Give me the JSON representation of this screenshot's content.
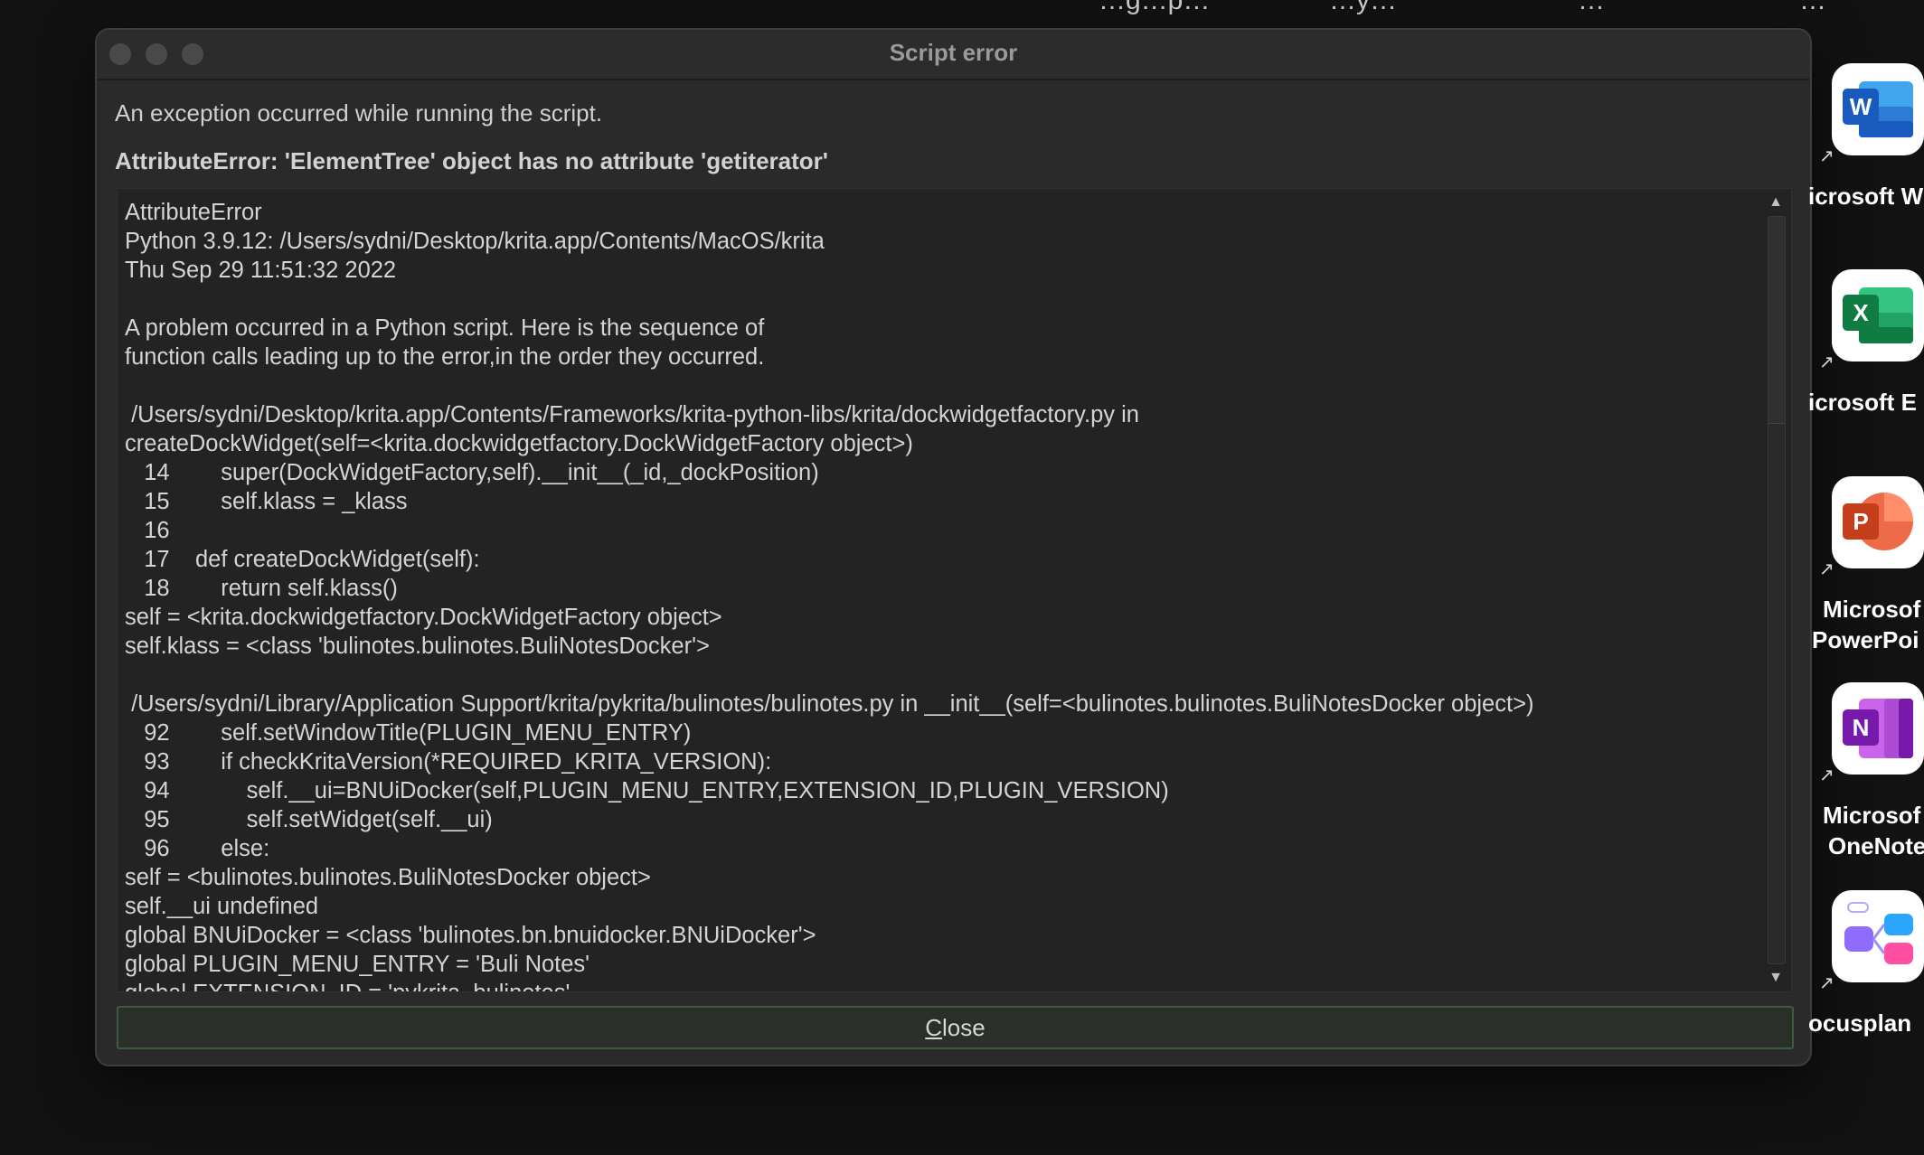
{
  "desktop": {
    "top_labels": [
      "…g…p…",
      "…y…",
      "…",
      "…"
    ]
  },
  "window": {
    "title": "Script error",
    "message": "An exception occurred while running the script.",
    "error_title": "AttributeError: 'ElementTree' object has no attribute 'getiterator'",
    "traceback_lines": [
      "AttributeError",
      "Python 3.9.12: /Users/sydni/Desktop/krita.app/Contents/MacOS/krita",
      "Thu Sep 29 11:51:32 2022",
      "",
      "A problem occurred in a Python script. Here is the sequence of",
      "function calls leading up to the error,in the order they occurred.",
      "",
      " /Users/sydni/Desktop/krita.app/Contents/Frameworks/krita-python-libs/krita/dockwidgetfactory.py in",
      "createDockWidget(self=<krita.dockwidgetfactory.DockWidgetFactory object>)",
      "   14        super(DockWidgetFactory,self).__init__(_id,_dockPosition)",
      "   15        self.klass = _klass",
      "   16",
      "   17    def createDockWidget(self):",
      "   18        return self.klass()",
      "self = <krita.dockwidgetfactory.DockWidgetFactory object>",
      "self.klass = <class 'bulinotes.bulinotes.BuliNotesDocker'>",
      "",
      " /Users/sydni/Library/Application Support/krita/pykrita/bulinotes/bulinotes.py in __init__(self=<bulinotes.bulinotes.BuliNotesDocker object>)",
      "   92        self.setWindowTitle(PLUGIN_MENU_ENTRY)",
      "   93        if checkKritaVersion(*REQUIRED_KRITA_VERSION):",
      "   94            self.__ui=BNUiDocker(self,PLUGIN_MENU_ENTRY,EXTENSION_ID,PLUGIN_VERSION)",
      "   95            self.setWidget(self.__ui)",
      "   96        else:",
      "self = <bulinotes.bulinotes.BuliNotesDocker object>",
      "self.__ui undefined",
      "global BNUiDocker = <class 'bulinotes.bn.bnuidocker.BNUiDocker'>",
      "global PLUGIN_MENU_ENTRY = 'Buli Notes'",
      "global EXTENSION_ID = 'pykrita_bulinotes'"
    ],
    "close_label_mnemonic": "C",
    "close_label_rest": "lose"
  },
  "dock": [
    {
      "label_lines": [
        "icrosoft W"
      ],
      "icon": "microsoft-word-icon",
      "letter": "W",
      "color": "#185ABD"
    },
    {
      "label_lines": [
        "icrosoft E"
      ],
      "icon": "microsoft-excel-icon",
      "letter": "X",
      "color": "#107C41"
    },
    {
      "label_lines": [
        "Microsof",
        "PowerPoi"
      ],
      "icon": "microsoft-powerpoint-icon",
      "letter": "P",
      "color": "#C43E1C"
    },
    {
      "label_lines": [
        "Microsof",
        "OneNote"
      ],
      "icon": "microsoft-onenote-icon",
      "letter": "N",
      "color": "#7719AA"
    },
    {
      "label_lines": [
        "ocusplan"
      ],
      "icon": "focusplan-icon",
      "letter": "",
      "color": "#7c5cff"
    }
  ]
}
